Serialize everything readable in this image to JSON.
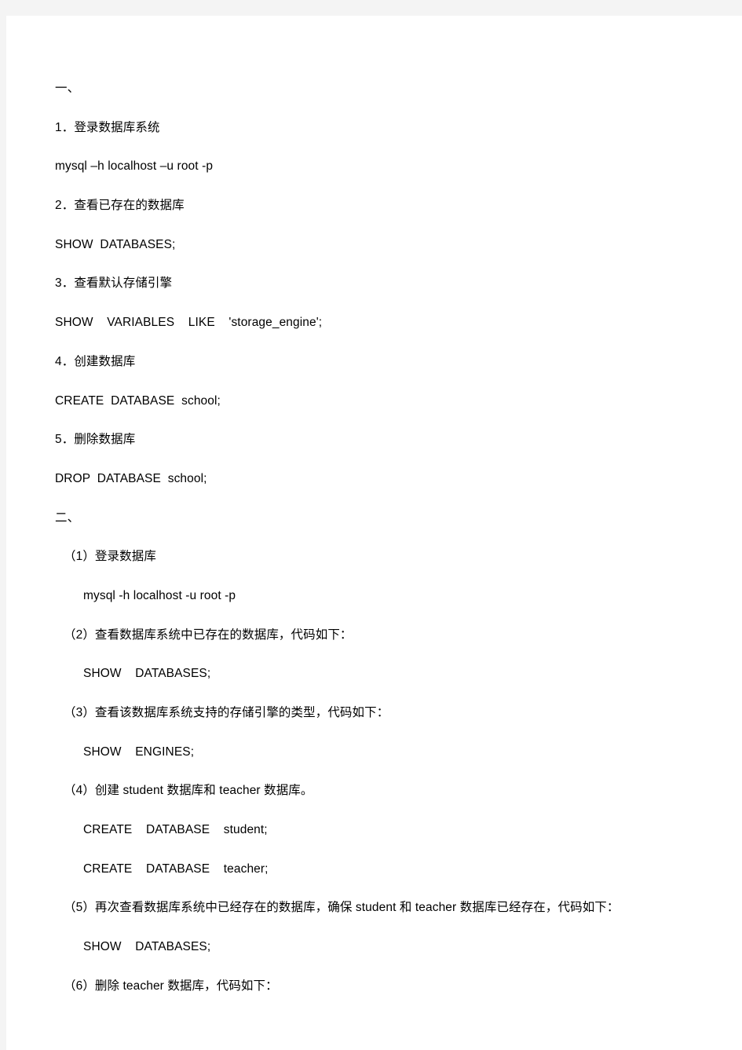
{
  "document": {
    "background_color": "#f4f4f4",
    "page_color": "#ffffff",
    "text_color": "#000000",
    "sections": [
      {
        "heading": "一、",
        "entries": [
          {
            "label": "1．登录数据库系统",
            "code": "mysql –h localhost –u root -p"
          },
          {
            "label": "2．查看已存在的数据库",
            "code": "SHOW  DATABASES;"
          },
          {
            "label": "3．查看默认存储引擎",
            "code": "SHOW    VARIABLES    LIKE    'storage_engine';"
          },
          {
            "label": "4．创建数据库",
            "code": "CREATE  DATABASE  school;"
          },
          {
            "label": "5．删除数据库",
            "code": "DROP  DATABASE  school;"
          }
        ]
      },
      {
        "heading": "二、",
        "entries": [
          {
            "label": "（1）登录数据库",
            "code": "mysql -h localhost -u root -p"
          },
          {
            "label": "（2）查看数据库系统中已存在的数据库，代码如下：",
            "code": "SHOW    DATABASES;"
          },
          {
            "label": "（3）查看该数据库系统支持的存储引擎的类型，代码如下：",
            "code": "SHOW    ENGINES;"
          },
          {
            "label": "（4）创建 student 数据库和 teacher 数据库。",
            "code": "CREATE    DATABASE    student;",
            "code2": "CREATE    DATABASE    teacher;"
          },
          {
            "label": "（5）再次查看数据库系统中已经存在的数据库，确保 student 和 teacher 数据库已经存在，代码如下：",
            "code": "SHOW    DATABASES;"
          },
          {
            "label": "（6）删除 teacher 数据库，代码如下："
          }
        ]
      }
    ]
  }
}
